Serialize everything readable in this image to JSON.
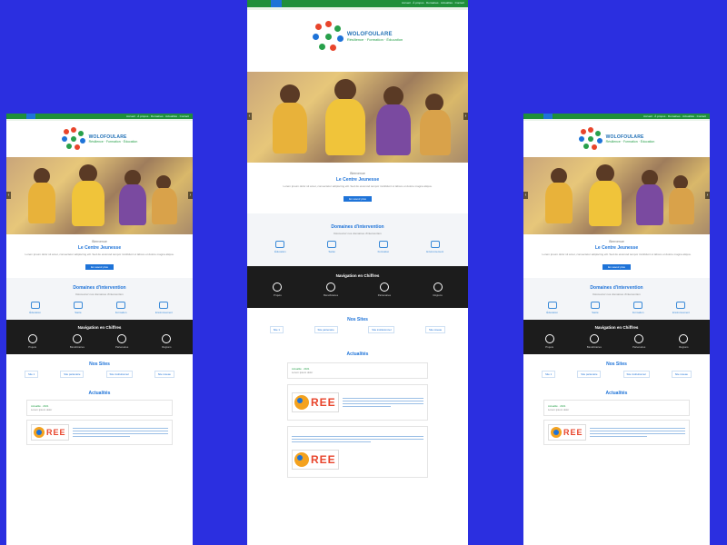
{
  "colors": {
    "page_background": "#2b2fe0",
    "topbar": "#1f8f3a",
    "accent": "#1e73d8",
    "figures_band": "#1c1c1c"
  },
  "brand": {
    "name_line1": "WOLOFOULARE",
    "name_line2": "Résilience · Formation · Éducation"
  },
  "top_nav": "Accueil · À propos · Domaines · Actualités · Contact",
  "hero": {
    "image": "children-photo"
  },
  "about": {
    "kicker": "Bienvenue",
    "title": "Le Centre Jeunesse",
    "body": "Lorem ipsum dolor sit amet, consectetur adipiscing elit. Sed do eiusmod tempor incididunt ut labore et dolore magna aliqua.",
    "button": "En savoir plus"
  },
  "domains": {
    "title": "Domaines d'intervention",
    "subtitle": "Découvrez nos domaines d'intervention",
    "items": [
      "Éducation",
      "Santé",
      "Formation",
      "Environnement"
    ]
  },
  "figures": {
    "title": "Navigation en Chiffres",
    "items": [
      "Projets",
      "Bénéficiaires",
      "Partenaires",
      "Régions"
    ]
  },
  "sites": {
    "title": "Nos Sites",
    "links": [
      "Site 1",
      "Site partenaire",
      "Site institutionnel",
      "Site réseau"
    ]
  },
  "news": {
    "title": "Actualités",
    "card1": {
      "meta": "Actualité · 2021",
      "text": "Lorem ipsum dolor"
    },
    "card2": {
      "brand": "REE",
      "meta": "Publié le",
      "text": "Lorem ipsum"
    },
    "card3": {
      "brand": "REE",
      "meta": "Publié le",
      "text": "Lorem ipsum"
    }
  }
}
